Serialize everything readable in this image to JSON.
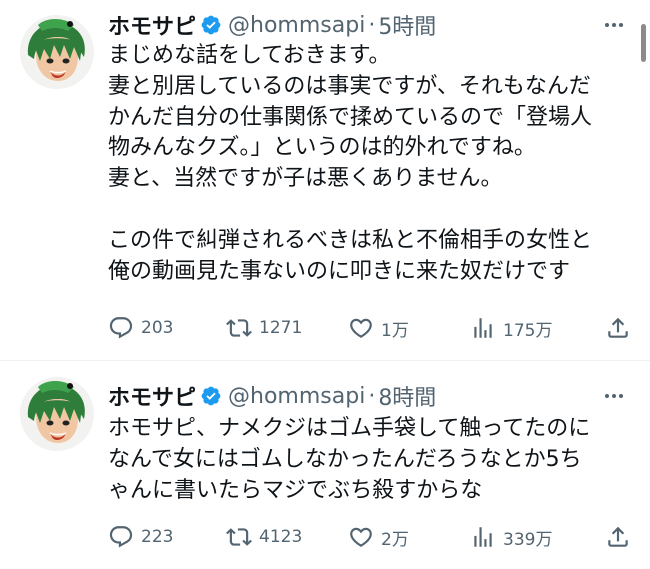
{
  "colors": {
    "text": "#0f1419",
    "secondary": "#536471",
    "verified": "#1d9bf0",
    "divider": "#eff3f4"
  },
  "tweets": [
    {
      "display_name": "ホモサピ",
      "handle": "@hommsapi",
      "separator": "·",
      "time": "5時間",
      "avatar_icon": "avatar-image",
      "text_lines": [
        "まじめな話をしておきます。",
        "妻と別居しているのは事実ですが、それもなんだ",
        "かんだ自分の仕事関係で揉めているので「登場人",
        "物みんなクズ。」というのは的外れですね。",
        "妻と、当然ですが子は悪くありません。",
        "",
        "この件で糾弾されるべきは私と不倫相手の女性と",
        "俺の動画見た事ないのに叩きに来た奴だけです"
      ],
      "replies": "203",
      "retweets": "1271",
      "likes": "1万",
      "views": "175万"
    },
    {
      "display_name": "ホモサピ",
      "handle": "@hommsapi",
      "separator": "·",
      "time": "8時間",
      "avatar_icon": "avatar-image",
      "text_lines": [
        "ホモサピ、ナメクジはゴム手袋して触ってたのに",
        "なんで女にはゴムしなかったんだろうなとか5ち",
        "ゃんに書いたらマジでぶち殺すからな"
      ],
      "replies": "223",
      "retweets": "4123",
      "likes": "2万",
      "views": "339万"
    }
  ],
  "icons": {
    "reply": "reply-icon",
    "retweet": "retweet-icon",
    "like": "heart-icon",
    "views": "views-icon",
    "share": "share-icon",
    "more": "more-icon",
    "verified": "verified-badge-icon"
  }
}
